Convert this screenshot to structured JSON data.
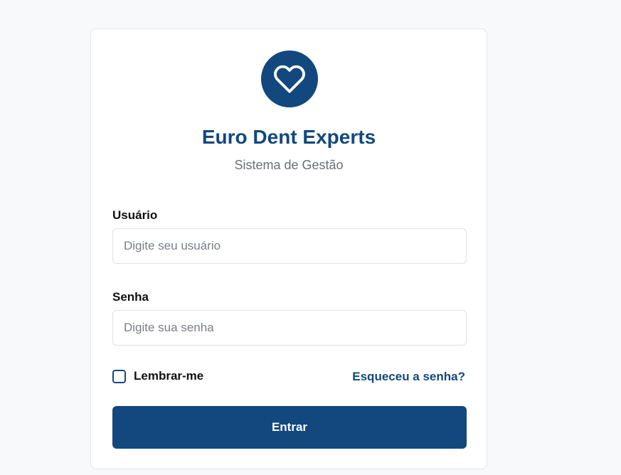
{
  "brand": {
    "title": "Euro Dent Experts",
    "subtitle": "Sistema de Gestão",
    "icon": "heart-icon",
    "accent_color": "#12487e"
  },
  "form": {
    "username": {
      "label": "Usuário",
      "placeholder": "Digite seu usuário",
      "value": ""
    },
    "password": {
      "label": "Senha",
      "placeholder": "Digite sua senha",
      "value": ""
    },
    "remember": {
      "label": "Lembrar-me",
      "checked": false
    },
    "forgot_link": "Esqueceu a senha?",
    "submit_label": "Entrar"
  }
}
